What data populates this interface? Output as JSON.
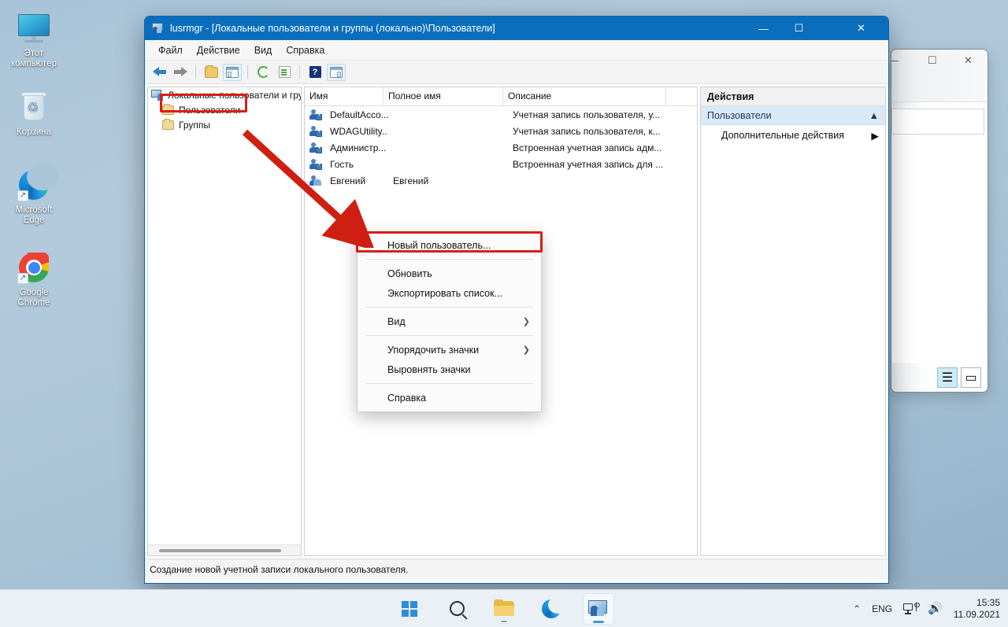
{
  "desktop": {
    "icons": [
      {
        "name": "this-computer",
        "label": "Этот\nкомпьютер",
        "label_line1": "Этот",
        "label_line2": "компьютер"
      },
      {
        "name": "recycle-bin",
        "label": "Корзина",
        "label_line1": "Корзина",
        "label_line2": ""
      },
      {
        "name": "microsoft-edge",
        "label": "Microsoft Edge",
        "label_line1": "Microsoft",
        "label_line2": "Edge"
      },
      {
        "name": "google-chrome",
        "label": "Google Chrome",
        "label_line1": "Google",
        "label_line2": "Chrome"
      }
    ]
  },
  "window": {
    "title": "lusrmgr - [Локальные пользователи и группы (локально)\\Пользователи]",
    "title_bar_color": "#0a6ebd",
    "controls": {
      "minimize": "—",
      "maximize": "☐",
      "close": "✕"
    },
    "menu": [
      {
        "label": "Файл"
      },
      {
        "label": "Действие"
      },
      {
        "label": "Вид"
      },
      {
        "label": "Справка"
      }
    ],
    "toolbar": [
      {
        "name": "back-icon",
        "tooltip": "Назад"
      },
      {
        "name": "forward-icon",
        "tooltip": "Вперед"
      },
      {
        "name": "up-folder-icon",
        "tooltip": "Вверх"
      },
      {
        "name": "show-console-tree-icon",
        "tooltip": "Показать/скрыть дерево консоли"
      },
      {
        "name": "refresh-icon",
        "tooltip": "Обновить"
      },
      {
        "name": "export-list-icon",
        "tooltip": "Экспортировать список"
      },
      {
        "name": "help-icon",
        "tooltip": "Справка"
      },
      {
        "name": "show-action-pane-icon",
        "tooltip": "Показать/скрыть область действий"
      }
    ],
    "status": "Создание новой учетной записи локального пользователя."
  },
  "tree": {
    "root": "Локальные пользователи и гру",
    "items": [
      {
        "label": "Пользователи",
        "selected": true
      },
      {
        "label": "Группы",
        "selected": false
      }
    ]
  },
  "list": {
    "columns": [
      "Имя",
      "Полное имя",
      "Описание"
    ],
    "rows": [
      {
        "name": "DefaultAcco...",
        "full_name": "",
        "description": "Учетная запись пользователя, у...",
        "icon": "user-disabled-icon"
      },
      {
        "name": "WDAGUtility...",
        "full_name": "",
        "description": "Учетная запись пользователя, к...",
        "icon": "user-disabled-icon"
      },
      {
        "name": "Администр...",
        "full_name": "",
        "description": "Встроенная учетная запись адм...",
        "icon": "user-disabled-icon"
      },
      {
        "name": "Гость",
        "full_name": "",
        "description": "Встроенная учетная запись для ...",
        "icon": "user-disabled-icon"
      },
      {
        "name": "Евгений",
        "full_name": "Евгений",
        "description": "",
        "icon": "user-icon"
      }
    ]
  },
  "actions": {
    "title": "Действия",
    "group": "Пользователи",
    "items": [
      {
        "label": "Дополнительные действия",
        "has_submenu": true
      }
    ]
  },
  "context_menu": {
    "items": [
      {
        "label": "Новый пользователь...",
        "highlighted": true,
        "submenu": false
      },
      {
        "separator": true
      },
      {
        "label": "Обновить",
        "submenu": false
      },
      {
        "label": "Экспортировать список...",
        "submenu": false
      },
      {
        "separator": true
      },
      {
        "label": "Вид",
        "submenu": true
      },
      {
        "separator": true
      },
      {
        "label": "Упорядочить значки",
        "submenu": true
      },
      {
        "label": "Выровнять значки",
        "submenu": false
      },
      {
        "separator": true
      },
      {
        "label": "Справка",
        "submenu": false
      }
    ],
    "submenu_glyph": "❯"
  },
  "annotations": {
    "highlight_color": "#d81f13",
    "arrow": "red-arrow-pointing-to-new-user-menu-item"
  },
  "taskbar": {
    "apps": [
      {
        "name": "start-button",
        "label": "Пуск"
      },
      {
        "name": "search-icon",
        "label": "Поиск"
      },
      {
        "name": "file-explorer-icon",
        "label": "Проводник"
      },
      {
        "name": "microsoft-edge-icon",
        "label": "Microsoft Edge"
      },
      {
        "name": "lusrmgr-icon",
        "label": "lusrmgr",
        "active": true
      }
    ],
    "tray": {
      "chevron": "⌃",
      "language": "ENG",
      "network_icon": "network-icon",
      "volume_icon": "volume-icon",
      "time": "15:35",
      "date": "11.09.2021"
    }
  }
}
